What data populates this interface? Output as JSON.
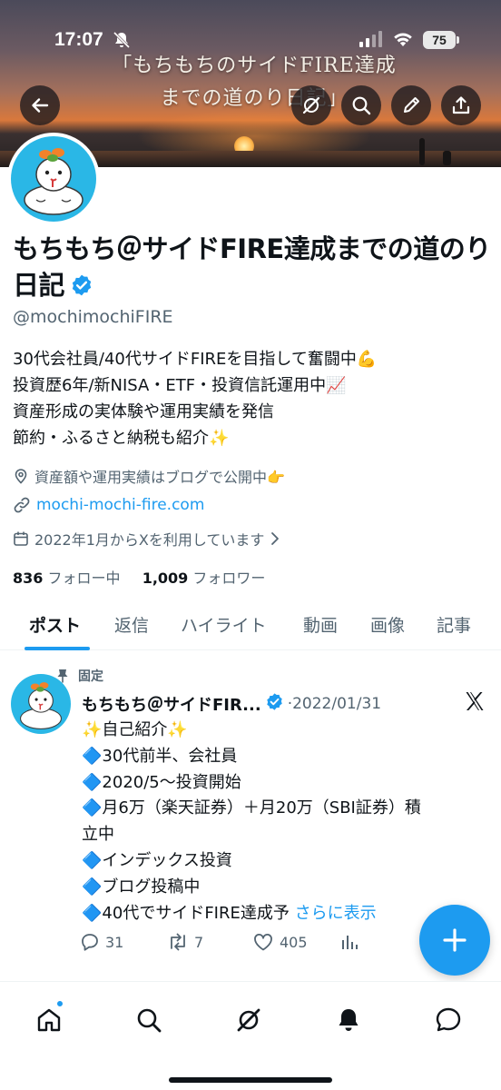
{
  "status_bar": {
    "time": "17:07",
    "battery": "75"
  },
  "banner": {
    "caption_line1": "「もちもちのサイドFIRE達成",
    "caption_line2": "までの道のり日記」"
  },
  "profile": {
    "name": "もちもち＠サイドFIRE達成までの道のり日記",
    "handle": "@mochimochiFIRE",
    "bio": [
      "30代会社員/40代サイドFIREを目指して奮闘中💪",
      "投資歴6年/新NISA・ETF・投資信託運用中📈",
      "資産形成の実体験や運用実績を発信",
      "節約・ふるさと納税も紹介✨"
    ],
    "location": "資産額や運用実績はブログで公開中👉",
    "website": "mochi-mochi-fire.com",
    "joined": "2022年1月からXを利用しています",
    "following_count": "836",
    "following_label": "フォロー中",
    "followers_count": "1,009",
    "followers_label": "フォロワー"
  },
  "tabs": [
    "ポスト",
    "返信",
    "ハイライト",
    "動画",
    "画像",
    "記事"
  ],
  "active_tab": 0,
  "pinned_tweet": {
    "pinned_label": "固定",
    "author": "もちもち＠サイドFIR...",
    "separator": "·",
    "date": "2022/01/31",
    "lines": [
      "✨自己紹介✨",
      "🔷30代前半、会社員",
      "🔷2020/5〜投資開始",
      "🔷月6万（楽天証券）＋月20万（SBI証券）積",
      "立中",
      "🔷インデックス投資",
      "🔷ブログ投稿中",
      "🔷40代でサイドFIRE達成予"
    ],
    "show_more": "さらに表示",
    "replies": "31",
    "retweets": "7",
    "likes": "405"
  },
  "colors": {
    "accent": "#1d9bf0",
    "text": "#0f1419",
    "secondary": "#536471"
  }
}
